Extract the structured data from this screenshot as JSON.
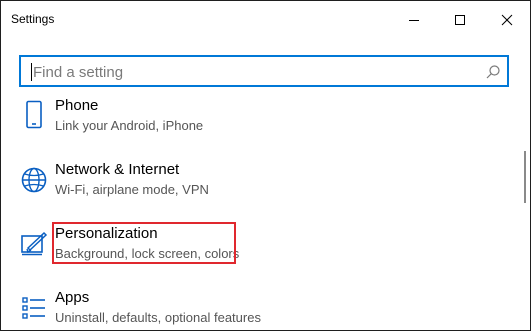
{
  "window": {
    "title": "Settings"
  },
  "controls": {
    "minimize": "minimize-icon",
    "maximize": "maximize-icon",
    "close": "close-icon"
  },
  "search": {
    "placeholder": "Find a setting",
    "icon": "search-icon"
  },
  "items": [
    {
      "label": "Phone",
      "desc": "Link your Android, iPhone",
      "icon": "phone-icon"
    },
    {
      "label": "Network & Internet",
      "desc": "Wi-Fi, airplane mode, VPN",
      "icon": "globe-icon"
    },
    {
      "label": "Personalization",
      "desc": "Background, lock screen, colors",
      "icon": "personalization-icon"
    },
    {
      "label": "Apps",
      "desc": "Uninstall, defaults, optional features",
      "icon": "apps-list-icon"
    }
  ],
  "colors": {
    "accent": "#0078d7",
    "highlight": "#e0282e",
    "icon": "#0a5fc2"
  }
}
